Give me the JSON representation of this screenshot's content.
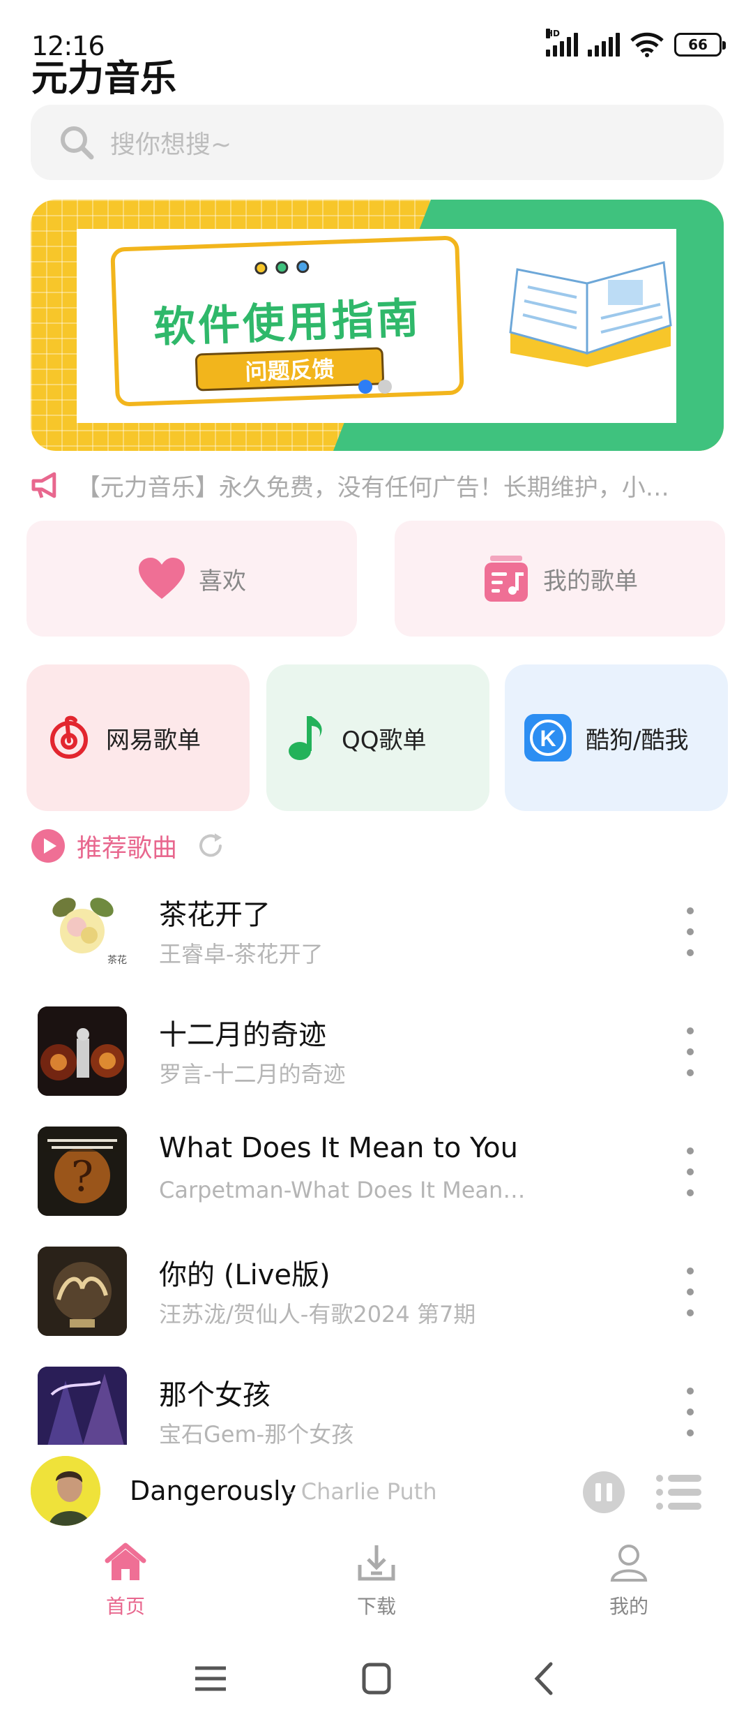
{
  "status_bar": {
    "time": "12:16",
    "battery": "66"
  },
  "app": {
    "title": "元力音乐"
  },
  "search": {
    "placeholder": "搜你想搜~"
  },
  "banner": {
    "title": "软件使用指南",
    "button": "问题反馈",
    "pages": 2,
    "active_page": 1
  },
  "notice": {
    "text": "【元力音乐】永久免费，没有任何广告！长期维护，小…"
  },
  "quick": {
    "like_label": "喜欢",
    "playlist_label": "我的歌单"
  },
  "platforms": [
    {
      "label": "网易歌单",
      "color": "#fde8ea"
    },
    {
      "label": "QQ歌单",
      "color": "#eaf6ee"
    },
    {
      "label": "酷狗/酷我",
      "color": "#e9f2fd"
    }
  ],
  "recommend": {
    "title": "推荐歌曲"
  },
  "songs": [
    {
      "title": "茶花开了",
      "subtitle": "王睿卓-茶花开了"
    },
    {
      "title": "十二月的奇迹",
      "subtitle": "罗言-十二月的奇迹"
    },
    {
      "title": "What Does It Mean to You",
      "subtitle": "Carpetman-What Does It Mean…"
    },
    {
      "title": "你的 (Live版)",
      "subtitle": "汪苏泷/贺仙人-有歌2024 第7期"
    },
    {
      "title": "那个女孩",
      "subtitle": "宝石Gem-那个女孩"
    }
  ],
  "player": {
    "title": "Dangerously",
    "artist": "- Charlie Puth"
  },
  "tabs": [
    {
      "label": "首页",
      "active": true
    },
    {
      "label": "下载",
      "active": false
    },
    {
      "label": "我的",
      "active": false
    }
  ],
  "colors": {
    "accent": "#e8678e",
    "banner_yellow": "#f7c62a",
    "banner_green": "#3fc27e"
  }
}
